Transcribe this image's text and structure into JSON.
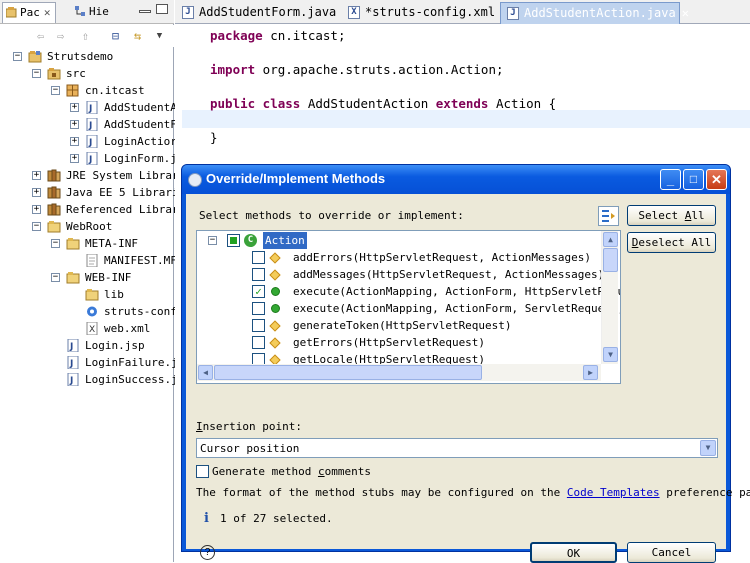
{
  "left_panel": {
    "tabs": [
      {
        "label": "Pac",
        "close": "✕"
      },
      {
        "label": "Hie"
      }
    ],
    "tree": [
      {
        "label": "Strutsdemo",
        "level": 0,
        "icon": "project-icon",
        "expander": "−"
      },
      {
        "label": "src",
        "level": 1,
        "icon": "source-folder-icon",
        "expander": "−"
      },
      {
        "label": "cn.itcast",
        "level": 2,
        "icon": "package-icon",
        "expander": "−"
      },
      {
        "label": "AddStudentA",
        "level": 3,
        "icon": "java-file-icon",
        "expander": "+"
      },
      {
        "label": "AddStudentF",
        "level": 3,
        "icon": "java-file-icon",
        "expander": "+"
      },
      {
        "label": "LoginActior",
        "level": 3,
        "icon": "java-file-icon",
        "expander": "+"
      },
      {
        "label": "LoginForm.j",
        "level": 3,
        "icon": "java-file-icon",
        "expander": "+"
      },
      {
        "label": "JRE System Librar",
        "level": 1,
        "icon": "library-icon",
        "expander": "+"
      },
      {
        "label": "Java EE 5 Librari",
        "level": 1,
        "icon": "library-icon",
        "expander": "+"
      },
      {
        "label": "Referenced Librar",
        "level": 1,
        "icon": "library-icon",
        "expander": "+"
      },
      {
        "label": "WebRoot",
        "level": 1,
        "icon": "folder-icon",
        "expander": "−"
      },
      {
        "label": "META-INF",
        "level": 2,
        "icon": "folder-icon",
        "expander": "−"
      },
      {
        "label": "MANIFEST.MF",
        "level": 3,
        "icon": "file-icon",
        "expander": ""
      },
      {
        "label": "WEB-INF",
        "level": 2,
        "icon": "folder-icon",
        "expander": "−"
      },
      {
        "label": "lib",
        "level": 3,
        "icon": "folder-icon",
        "expander": ""
      },
      {
        "label": "struts-conf",
        "level": 3,
        "icon": "gear-icon",
        "expander": ""
      },
      {
        "label": "web.xml",
        "level": 3,
        "icon": "xml-file-icon",
        "expander": ""
      },
      {
        "label": "Login.jsp",
        "level": 2,
        "icon": "jsp-file-icon",
        "expander": ""
      },
      {
        "label": "LoginFailure.j",
        "level": 2,
        "icon": "jsp-file-icon",
        "expander": ""
      },
      {
        "label": "LoginSuccess.j",
        "level": 2,
        "icon": "jsp-file-icon",
        "expander": ""
      }
    ]
  },
  "editor": {
    "tabs": [
      {
        "label": "AddStudentForm.java",
        "icon": "J",
        "active": false
      },
      {
        "label": "*struts-config.xml",
        "icon": "X",
        "active": false
      },
      {
        "label": "AddStudentAction.java",
        "icon": "J",
        "active": true,
        "close": "✕"
      }
    ],
    "code": [
      {
        "kw": "package",
        "rest": " cn.itcast;"
      },
      {
        "kw": "",
        "rest": ""
      },
      {
        "kw": "import",
        "rest": " org.apache.struts.action.Action;"
      },
      {
        "kw": "",
        "rest": ""
      },
      {
        "kw": "public class",
        "rest": " AddStudentAction ",
        "kw2": "extends",
        "rest2": " Action {"
      },
      {
        "kw": "",
        "rest": ""
      },
      {
        "kw": "",
        "rest": "}"
      }
    ]
  },
  "dialog": {
    "title": "Override/Implement Methods",
    "buttons": {
      "minimize": "_",
      "maximize": "□",
      "close": "✕"
    },
    "prompt": "Select methods to override or implement:",
    "select_all": {
      "pre": "Select ",
      "ul": "A",
      "post": "ll"
    },
    "deselect_all": {
      "pre": "",
      "ul": "D",
      "post": "eselect All"
    },
    "class_node": "Action",
    "methods": [
      {
        "name": "addErrors(HttpServletRequest, ActionMessages)",
        "checked": false,
        "visibility": "protected"
      },
      {
        "name": "addMessages(HttpServletRequest, ActionMessages)",
        "checked": false,
        "visibility": "protected"
      },
      {
        "name": "execute(ActionMapping, ActionForm, HttpServletReque",
        "checked": true,
        "visibility": "public"
      },
      {
        "name": "execute(ActionMapping, ActionForm, ServletRequest, S",
        "checked": false,
        "visibility": "public"
      },
      {
        "name": "generateToken(HttpServletRequest)",
        "checked": false,
        "visibility": "protected"
      },
      {
        "name": "getErrors(HttpServletRequest)",
        "checked": false,
        "visibility": "protected"
      },
      {
        "name": "getLocale(HttpServletRequest)",
        "checked": false,
        "visibility": "protected"
      }
    ],
    "insertion_label": {
      "ul": "I",
      "post": "nsertion point:"
    },
    "insertion_value": "Cursor position",
    "generate_comments": {
      "pre": "Generate method ",
      "ul": "c",
      "post": "omments",
      "checked": false
    },
    "stub_note_pre": "The format of the method stubs may be configured on the ",
    "stub_note_link": "Code Templates",
    "stub_note_post": " preference page.",
    "status": "1 of 27 selected.",
    "ok_label": "OK",
    "cancel_label": "Cancel",
    "help": "?"
  }
}
